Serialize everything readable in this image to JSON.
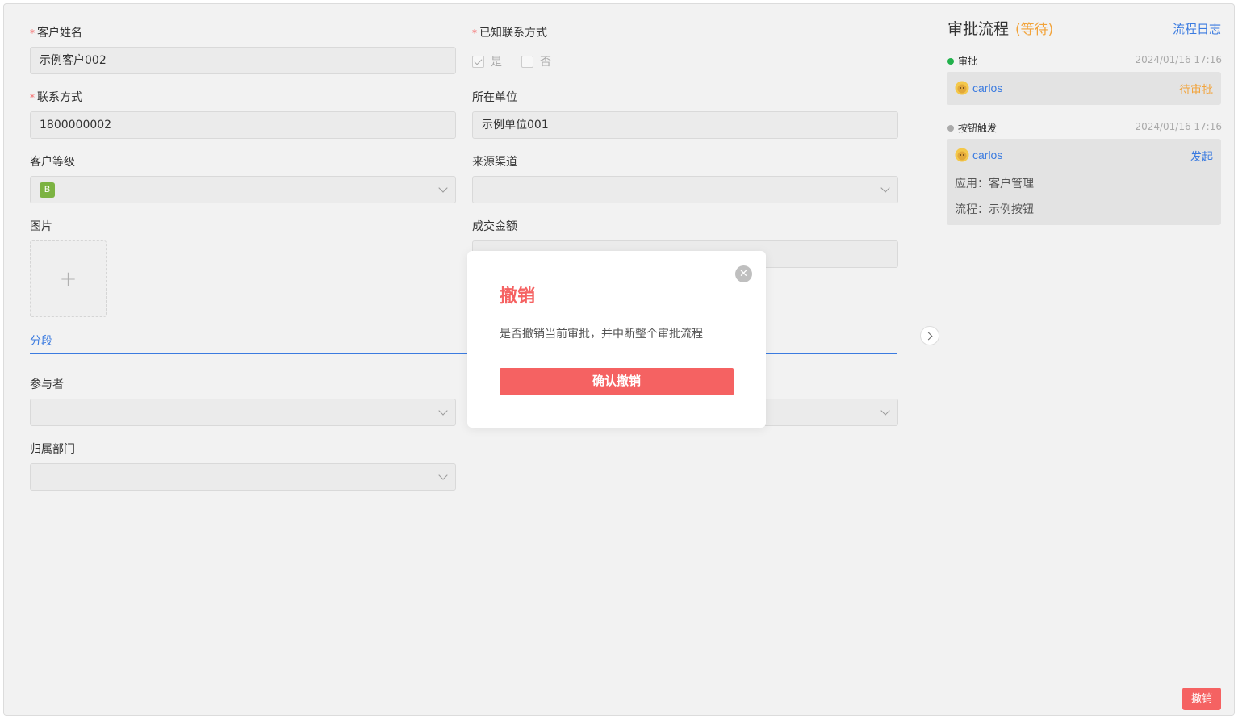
{
  "form": {
    "customer_name": {
      "label": "客户姓名",
      "value": "示例客户002"
    },
    "known_contact": {
      "label": "已知联系方式",
      "option_yes": "是",
      "option_no": "否"
    },
    "contact": {
      "label": "联系方式",
      "value": "1800000002"
    },
    "company": {
      "label": "所在单位",
      "value": "示例单位001"
    },
    "customer_level": {
      "label": "客户等级",
      "value": "B",
      "badge_color": "#7cb342"
    },
    "source_channel": {
      "label": "来源渠道",
      "value": ""
    },
    "image": {
      "label": "图片"
    },
    "deal_amount": {
      "label": "成交金额",
      "value": ""
    },
    "section": {
      "label": "分段"
    },
    "participants": {
      "label": "参与者",
      "value": ""
    },
    "department": {
      "label": "归属部门",
      "value": ""
    }
  },
  "panel": {
    "title": "审批流程",
    "status": "(等待)",
    "log_link": "流程日志",
    "steps": [
      {
        "name": "审批",
        "time": "2024/01/16 17:16",
        "dot_color": "#22b14c",
        "user": "carlos",
        "status": "待审批",
        "status_color": "#f2a33a"
      },
      {
        "name": "按钮触发",
        "time": "2024/01/16 17:16",
        "dot_color": "#aaaaaa",
        "user": "carlos",
        "status": "发起",
        "status_color": "#3b7be0",
        "details": [
          "应用：客户管理",
          "流程：示例按钮"
        ]
      }
    ]
  },
  "footer": {
    "revoke_label": "撤销"
  },
  "modal": {
    "title": "撤销",
    "message": "是否撤销当前审批，并中断整个审批流程",
    "confirm_label": "确认撤销"
  },
  "colors": {
    "accent": "#3b7be0",
    "danger": "#f56262",
    "warning": "#f2a33a"
  },
  "icons": [
    "check-icon",
    "chevron-down-icon",
    "plus-icon",
    "chevron-right-icon",
    "avatar-icon",
    "close-icon"
  ]
}
